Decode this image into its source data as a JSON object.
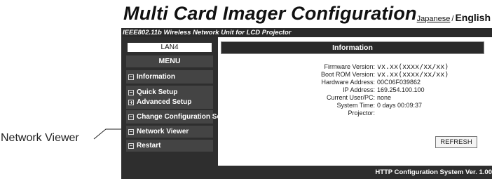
{
  "callout": {
    "label": "Network Viewer"
  },
  "app": {
    "title": "Multi Card Imager Configuration",
    "subtitle": "IEEE802.11b Wireless Network Unit for LCD Projector"
  },
  "languages": {
    "japanese": "Japanese",
    "separator": "/",
    "english": "English"
  },
  "sidebar": {
    "lan": "LAN4",
    "menu_label": "MENU",
    "items": [
      {
        "label": "Information",
        "icon": "minus-box-icon"
      },
      {
        "label": "Quick Setup",
        "icon": "minus-box-icon"
      },
      {
        "label": "Advanced Setup",
        "icon": "plus-box-icon"
      },
      {
        "label": "Change Configuration Set",
        "icon": "minus-box-icon"
      },
      {
        "label": "Network Viewer",
        "icon": "minus-box-icon"
      },
      {
        "label": "Restart",
        "icon": "minus-box-icon"
      }
    ]
  },
  "main": {
    "header": "Information",
    "rows": [
      {
        "label": "Firmware Version:",
        "value": "vx.xx(xxxx/xx/xx)"
      },
      {
        "label": "Boot ROM Version:",
        "value": "vx.xx(xxxx/xx/xx)"
      },
      {
        "label": "Hardware Address:",
        "value": "00C06F039862"
      },
      {
        "label": "IP Address:",
        "value": "169.254.100.100"
      },
      {
        "label": "Current User/PC:",
        "value": "none"
      },
      {
        "label": "System Time:",
        "value": "0 days 00:09:37"
      },
      {
        "label": "Projector:",
        "value": ""
      }
    ],
    "refresh_label": "REFRESH"
  },
  "footer": {
    "text": "HTTP Configuration System Ver. 1.00"
  },
  "colors": {
    "dark_bar": "#2a2a2a",
    "menu_item": "#444444",
    "sidebar_bg": "#2e2e2e"
  }
}
